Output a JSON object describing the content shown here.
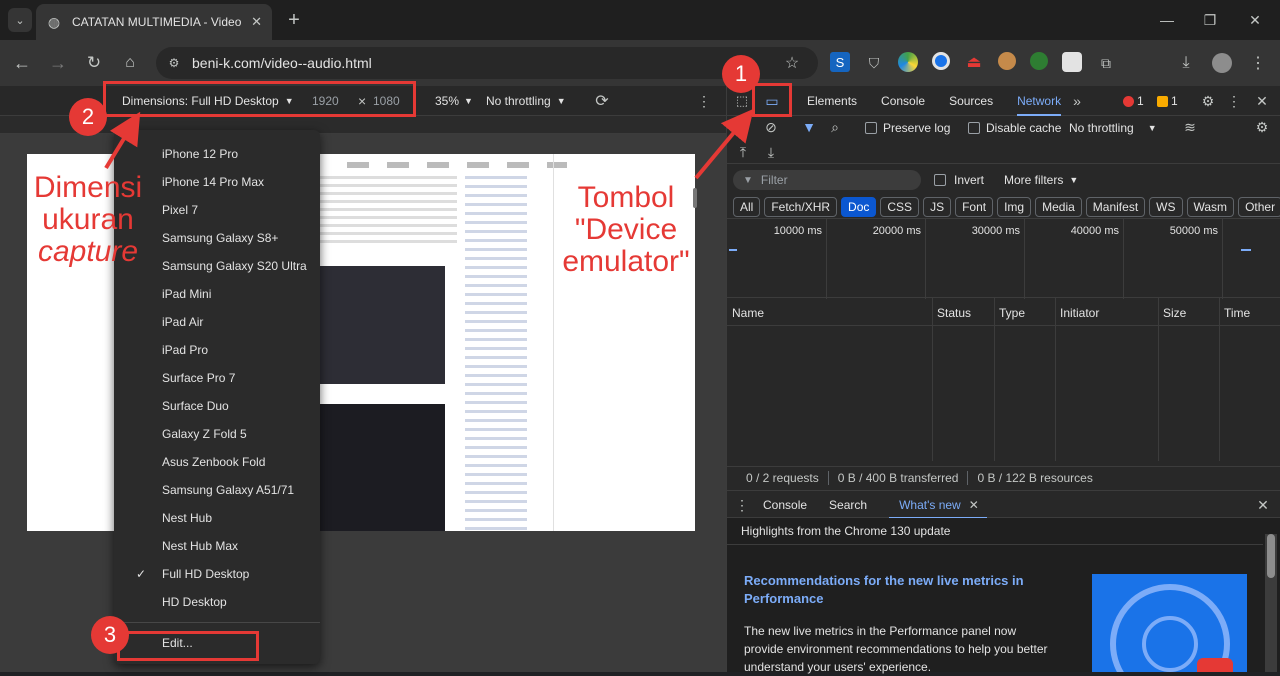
{
  "browser": {
    "tab_title": "CATATAN MULTIMEDIA - Video",
    "url": "beni-k.com/video--audio.html"
  },
  "emulation": {
    "dimensions_label": "Dimensions: Full HD Desktop",
    "width": "1920",
    "times": "×",
    "height": "1080",
    "zoom": "35%",
    "throttling": "No throttling"
  },
  "devices": [
    "iPhone 12 Pro",
    "iPhone 14 Pro Max",
    "Pixel 7",
    "Samsung Galaxy S8+",
    "Samsung Galaxy S20 Ultra",
    "iPad Mini",
    "iPad Air",
    "iPad Pro",
    "Surface Pro 7",
    "Surface Duo",
    "Galaxy Z Fold 5",
    "Asus Zenbook Fold",
    "Samsung Galaxy A51/71",
    "Nest Hub",
    "Nest Hub Max",
    "Full HD Desktop",
    "HD Desktop"
  ],
  "selected_device": "Full HD Desktop",
  "edit_label": "Edit...",
  "devtools": {
    "tabs": [
      "Elements",
      "Console",
      "Sources",
      "Network"
    ],
    "active_tab": "Network",
    "errors": "1",
    "warnings": "1",
    "preserve_log": "Preserve log",
    "disable_cache": "Disable cache",
    "throttling": "No throttling",
    "filter_placeholder": "Filter",
    "invert": "Invert",
    "more_filters": "More filters",
    "filter_chips": [
      "All",
      "Fetch/XHR",
      "Doc",
      "CSS",
      "JS",
      "Font",
      "Img",
      "Media",
      "Manifest",
      "WS",
      "Wasm",
      "Other"
    ],
    "active_chip": "Doc",
    "timeline": [
      "10000 ms",
      "20000 ms",
      "30000 ms",
      "40000 ms",
      "50000 ms"
    ],
    "columns": [
      "Name",
      "Status",
      "Type",
      "Initiator",
      "Size",
      "Time"
    ],
    "status": [
      "0 / 2 requests",
      "0 B / 400 B transferred",
      "0 B / 122 B resources"
    ],
    "drawer_tabs": [
      "Console",
      "Search",
      "What's new"
    ],
    "drawer_active": "What's new",
    "highlights": "Highlights from the Chrome 130 update",
    "news_title": "Recommendations for the new live metrics in Performance",
    "news_body": "The new live metrics in the Performance panel now provide environment recommendations to help you better understand your users' experience."
  },
  "annotations": {
    "badge1": "1",
    "badge2": "2",
    "badge3": "3",
    "left_text": [
      "Dimensi",
      "ukuran",
      "capture"
    ],
    "right_text": [
      "Tombol",
      "\"Device",
      "emulator\""
    ]
  },
  "colors": {
    "annotation": "#e53935",
    "active_blue": "#0b57d0"
  }
}
